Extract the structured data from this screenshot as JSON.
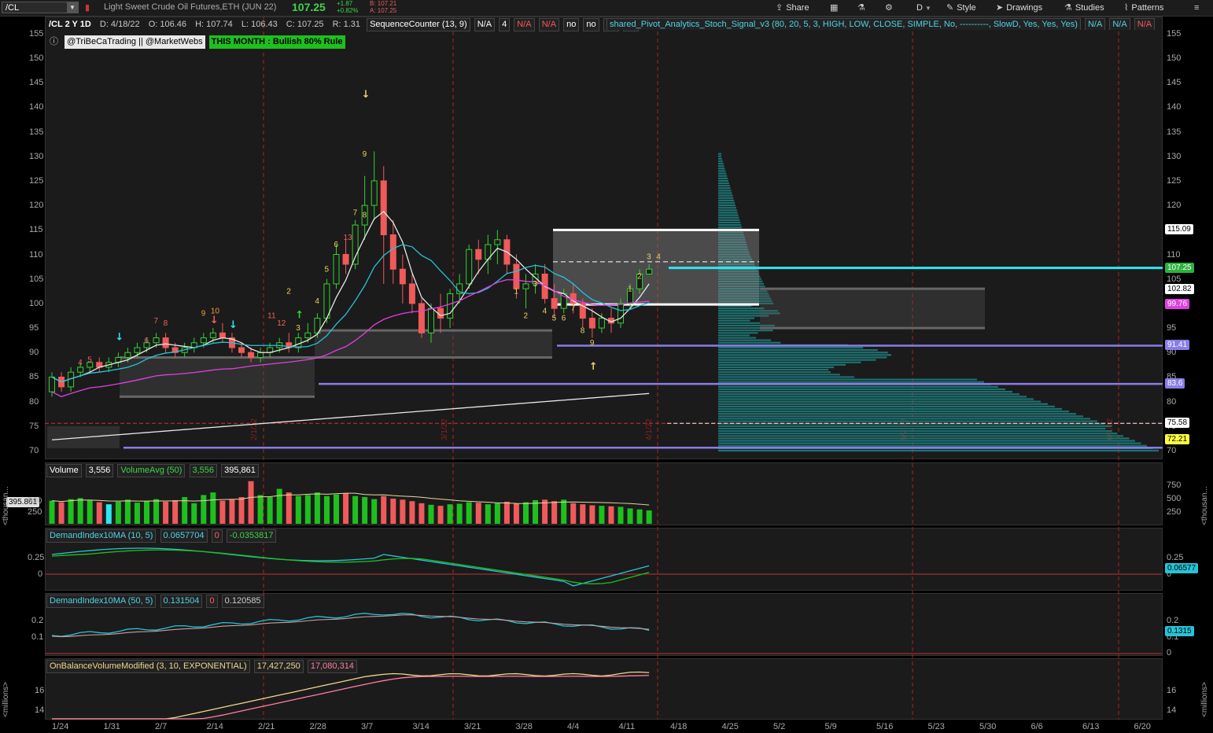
{
  "topbar": {
    "symbol": "/CL",
    "description": "Light Sweet Crude Oil Futures,ETH (JUN 22)",
    "last": "107.25",
    "change": "+1.87",
    "change_pct": "+0.82%",
    "bid": "B: 107.21",
    "ask": "A: 107.25",
    "buttons": {
      "share": "Share",
      "style": "Style",
      "drawings": "Drawings",
      "studies": "Studies",
      "patterns": "Patterns",
      "period": "D"
    }
  },
  "price_panel": {
    "title": "/CL 2 Y 1D",
    "ohlc": {
      "d": "D: 4/18/22",
      "o": "O: 106.46",
      "h": "H: 107.74",
      "l": "L: 106.43",
      "c": "C: 107.25",
      "r": "R: 1.31"
    },
    "study1": "SequenceCounter (13, 9)",
    "study1_vals": [
      "N/A",
      "4",
      "N/A",
      "N/A",
      "no",
      "no",
      "no",
      "no"
    ],
    "study2": "shared_Pivot_Analytics_Stoch_Signal_v3 (80, 20, 5, 3, HIGH, LOW, CLOSE, SIMPLE, No, ----------, SlowD, Yes, Yes, Yes)",
    "study2_vals": [
      "N/A",
      "N/A",
      "N/A"
    ],
    "handle": "@TriBeCaTrading || @MarketWebs",
    "banner": "THIS MONTH : Bullish 80% Rule",
    "yticks": [
      "155",
      "150",
      "145",
      "140",
      "135",
      "130",
      "125",
      "120",
      "115",
      "110",
      "105",
      "100",
      "95",
      "90",
      "85",
      "80",
      "75",
      "70"
    ],
    "tags": [
      {
        "text": "115.09",
        "bg": "#ffffff",
        "fg": "#000"
      },
      {
        "text": "107.25",
        "bg": "#2bb33d",
        "fg": "#fff"
      },
      {
        "text": "102.82",
        "bg": "#ffffff",
        "fg": "#000"
      },
      {
        "text": "99.76",
        "bg": "#e040e0",
        "fg": "#fff"
      },
      {
        "text": "91.41",
        "bg": "#8a7de8",
        "fg": "#fff"
      },
      {
        "text": "83.6",
        "bg": "#8a7de8",
        "fg": "#fff"
      },
      {
        "text": "75.58",
        "bg": "#ffffff",
        "fg": "#000"
      },
      {
        "text": "72.21",
        "bg": "#ffff40",
        "fg": "#000"
      }
    ]
  },
  "volume_panel": {
    "title": "Volume",
    "v1": "3,556",
    "avg_title": "VolumeAvg (50)",
    "v2": "3,556",
    "v3": "395,861",
    "left_tag": "395.861",
    "yticks": [
      "750",
      "500",
      "250"
    ],
    "unit": "<thousan..."
  },
  "di1_panel": {
    "title": "DemandIndex10MA (10, 5)",
    "v1": "0.0657704",
    "v2": "0",
    "v3": "-0.0353817",
    "yticks": [
      "0.25",
      "0"
    ],
    "tag": "0.06577"
  },
  "di2_panel": {
    "title": "DemandIndex10MA (50, 5)",
    "v1": "0.131504",
    "v2": "0",
    "v3": "0.120585",
    "yticks": [
      "0.2",
      "0.1",
      "0"
    ],
    "tag": "0.1315"
  },
  "obv_panel": {
    "title": "OnBalanceVolumeModified (3, 10, EXPONENTIAL)",
    "v1": "17,427,250",
    "v2": "17,080,314",
    "yticks": [
      "16",
      "14"
    ],
    "unit": "<millions>"
  },
  "xaxis": [
    "1/24",
    "1/31",
    "2/7",
    "2/14",
    "2/21",
    "2/28",
    "3/7",
    "3/14",
    "3/21",
    "3/28",
    "4/4",
    "4/11",
    "4/18",
    "4/25",
    "5/2",
    "5/9",
    "5/16",
    "5/23",
    "5/30",
    "6/6",
    "6/13",
    "6/20"
  ],
  "month_markers": [
    "2/1/22",
    "3/1/22",
    "4/1/22",
    "5/2/22",
    "6/1/22"
  ],
  "chart_data": {
    "type": "candlestick",
    "price_range": [
      69,
      155
    ],
    "candles": [
      [
        82,
        86,
        81,
        85
      ],
      [
        85,
        86,
        82,
        83
      ],
      [
        83,
        87,
        82,
        86
      ],
      [
        86,
        88,
        85,
        87
      ],
      [
        87,
        88,
        86,
        88
      ],
      [
        88,
        89,
        86,
        87
      ],
      [
        87,
        89,
        86,
        88
      ],
      [
        88,
        90,
        87,
        89
      ],
      [
        89,
        91,
        88,
        90
      ],
      [
        90,
        92,
        89,
        91
      ],
      [
        91,
        93,
        90,
        92
      ],
      [
        92,
        94,
        91,
        93
      ],
      [
        93,
        94,
        90,
        91
      ],
      [
        91,
        92,
        89,
        90
      ],
      [
        90,
        92,
        89,
        91
      ],
      [
        91,
        93,
        90,
        92
      ],
      [
        92,
        94,
        91,
        93
      ],
      [
        93,
        95,
        92,
        94
      ],
      [
        94,
        96,
        92,
        93
      ],
      [
        93,
        94,
        90,
        91
      ],
      [
        91,
        92,
        89,
        90
      ],
      [
        90,
        91,
        88,
        89
      ],
      [
        89,
        91,
        88,
        90
      ],
      [
        90,
        92,
        89,
        91
      ],
      [
        91,
        93,
        90,
        92
      ],
      [
        92,
        94,
        90,
        91
      ],
      [
        91,
        94,
        90,
        93
      ],
      [
        93,
        96,
        92,
        94
      ],
      [
        94,
        98,
        93,
        97
      ],
      [
        97,
        105,
        96,
        104
      ],
      [
        104,
        112,
        103,
        110
      ],
      [
        110,
        113,
        106,
        108
      ],
      [
        108,
        117,
        107,
        116
      ],
      [
        116,
        126,
        113,
        120
      ],
      [
        120,
        131,
        117,
        125
      ],
      [
        125,
        128,
        104,
        114
      ],
      [
        114,
        117,
        104,
        107
      ],
      [
        107,
        110,
        100,
        104
      ],
      [
        104,
        106,
        98,
        100
      ],
      [
        100,
        101,
        93,
        94
      ],
      [
        94,
        100,
        92,
        99
      ],
      [
        99,
        102,
        94,
        97
      ],
      [
        97,
        103,
        95,
        102
      ],
      [
        102,
        106,
        100,
        104
      ],
      [
        104,
        112,
        103,
        111
      ],
      [
        111,
        113,
        106,
        109
      ],
      [
        109,
        114,
        106,
        112
      ],
      [
        112,
        115,
        108,
        113
      ],
      [
        113,
        114,
        106,
        108
      ],
      [
        108,
        110,
        101,
        103
      ],
      [
        103,
        106,
        99,
        104
      ],
      [
        104,
        108,
        102,
        106
      ],
      [
        106,
        108,
        100,
        101
      ],
      [
        101,
        104,
        97,
        99
      ],
      [
        99,
        103,
        98,
        102
      ],
      [
        102,
        104,
        98,
        100
      ],
      [
        100,
        101,
        95,
        97
      ],
      [
        97,
        99,
        93,
        95
      ],
      [
        95,
        98,
        94,
        97
      ],
      [
        97,
        99,
        94,
        96
      ],
      [
        96,
        101,
        95,
        100
      ],
      [
        100,
        104,
        99,
        103
      ],
      [
        103,
        107,
        102,
        106
      ],
      [
        106,
        108,
        106,
        107
      ]
    ],
    "volume": [
      450,
      420,
      480,
      500,
      460,
      420,
      380,
      430,
      470,
      410,
      440,
      480,
      430,
      460,
      520,
      400,
      560,
      610,
      450,
      480,
      520,
      830,
      560,
      520,
      680,
      610,
      540,
      560,
      610,
      540,
      570,
      590,
      540,
      520,
      480,
      540,
      490,
      470,
      440,
      400,
      370,
      350,
      380,
      390,
      420,
      410,
      380,
      400,
      430,
      390,
      420,
      460,
      470,
      440,
      470,
      400,
      380,
      360,
      350,
      340,
      330,
      300,
      280,
      260
    ]
  }
}
